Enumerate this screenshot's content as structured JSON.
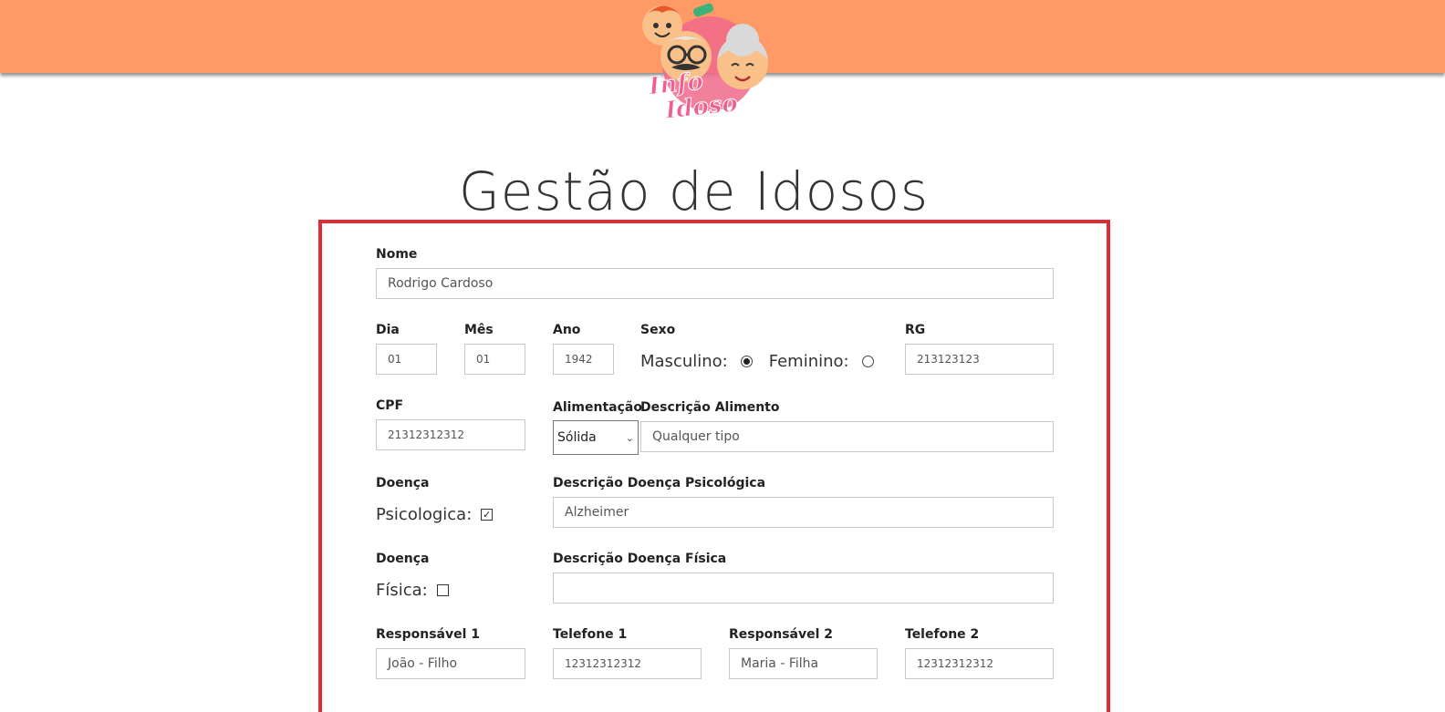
{
  "header": {
    "logo_text_line1": "Info",
    "logo_text_line2": "Idoso",
    "bar_color": "#ff9966"
  },
  "page_title": "Gestão de Idosos",
  "form": {
    "border_color": "#e02a36",
    "nome": {
      "label": "Nome",
      "value": "Rodrigo Cardoso"
    },
    "dia": {
      "label": "Dia",
      "value": "01"
    },
    "mes": {
      "label": "Mês",
      "value": "01"
    },
    "ano": {
      "label": "Ano",
      "value": "1942"
    },
    "sexo": {
      "label": "Sexo",
      "masculino_label": "Masculino:",
      "feminino_label": "Feminino:",
      "selected": "Masculino"
    },
    "rg": {
      "label": "RG",
      "value": "213123123"
    },
    "cpf": {
      "label": "CPF",
      "value": "21312312312"
    },
    "alimentacao": {
      "label": "Alimentação",
      "value": "Sólida"
    },
    "descricao_alimento": {
      "label": "Descrição Alimento",
      "value": "Qualquer tipo"
    },
    "doenca_psicologica": {
      "label": "Doença",
      "check_label": "Psicologica:",
      "checked": true
    },
    "descricao_doenca_psicologica": {
      "label": "Descrição Doença Psicológica",
      "value": "Alzheimer"
    },
    "doenca_fisica": {
      "label": "Doença",
      "check_label": "Física:",
      "checked": false
    },
    "descricao_doenca_fisica": {
      "label": "Descrição Doença Física",
      "value": ""
    },
    "responsavel1": {
      "label": "Responsável 1",
      "value": "João - Filho"
    },
    "telefone1": {
      "label": "Telefone 1",
      "value": "12312312312"
    },
    "responsavel2": {
      "label": "Responsável 2",
      "value": "Maria - Filha"
    },
    "telefone2": {
      "label": "Telefone 2",
      "value": "12312312312"
    }
  }
}
